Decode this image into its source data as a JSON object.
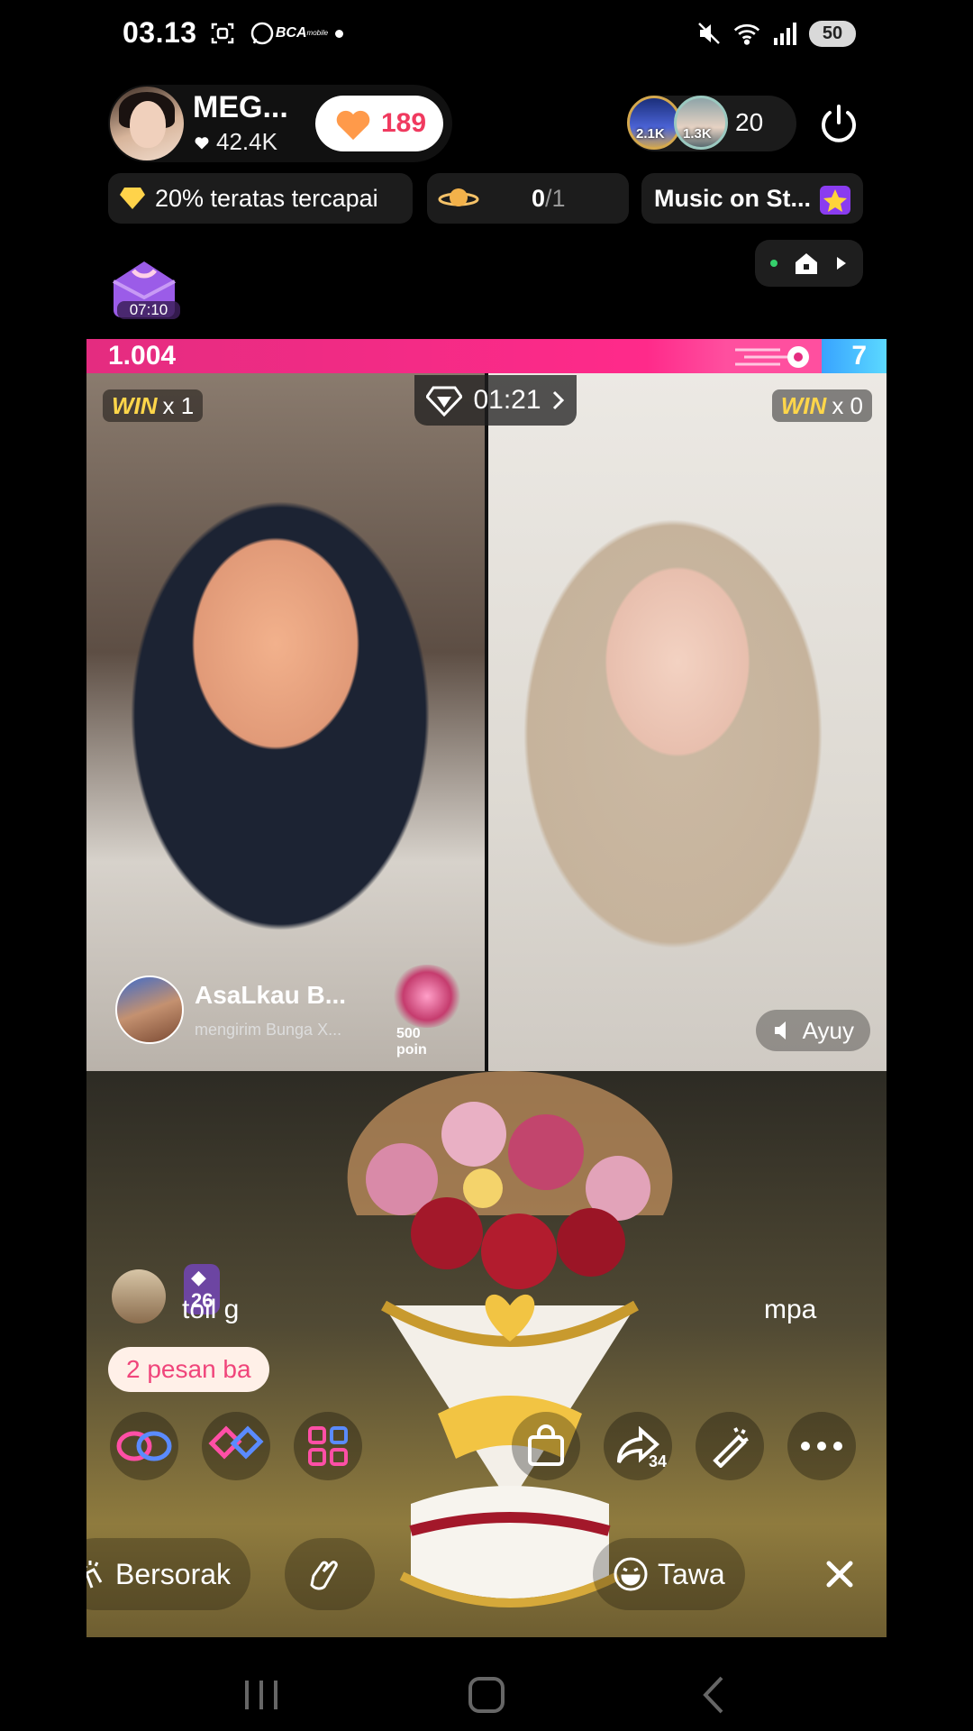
{
  "status_bar": {
    "time": "03.13",
    "bca_logo": "BCA",
    "bca_sub": "mobile",
    "battery": "50",
    "icons": [
      "screenshot-icon",
      "whatsapp-icon",
      "bca-mobile-icon",
      "mute-icon",
      "wifi-icon",
      "signal-icon",
      "battery-icon"
    ]
  },
  "host": {
    "name": "MEG...",
    "likes": "42.4K",
    "like_button_count": "189"
  },
  "viewers": {
    "top1_badge": "2.1K",
    "top2_badge": "1.3K",
    "count": "20"
  },
  "chips": {
    "rank_text": "20% teratas tercapai",
    "goal_value": "0",
    "goal_total": "/1",
    "music_text": "Music on St..."
  },
  "gift_box": {
    "timer": "07:10"
  },
  "battle": {
    "score_left": "1.004",
    "score_right": "7",
    "timer": "01:21",
    "left_win_label": "WIN",
    "left_win_count": "x 1",
    "right_win_label": "WIN",
    "right_win_count": "x 0",
    "opponent_name": "Ayuy"
  },
  "gift_toast": {
    "sender": "AsaLkau B...",
    "message": "mengirim Bunga X...",
    "points": "500 poin"
  },
  "chat": {
    "level": "26",
    "text_left": "toil g",
    "text_right": "mpa",
    "new_messages": "2 pesan ba"
  },
  "actions": {
    "share_count": "34"
  },
  "reactions": {
    "cheer": "Bersorak",
    "laugh": "Tawa"
  },
  "colors": {
    "score_pink": "#e42c80",
    "score_blue": "#38a3ff",
    "like_red": "#f03a5f",
    "win_yellow": "#ffd64a"
  }
}
